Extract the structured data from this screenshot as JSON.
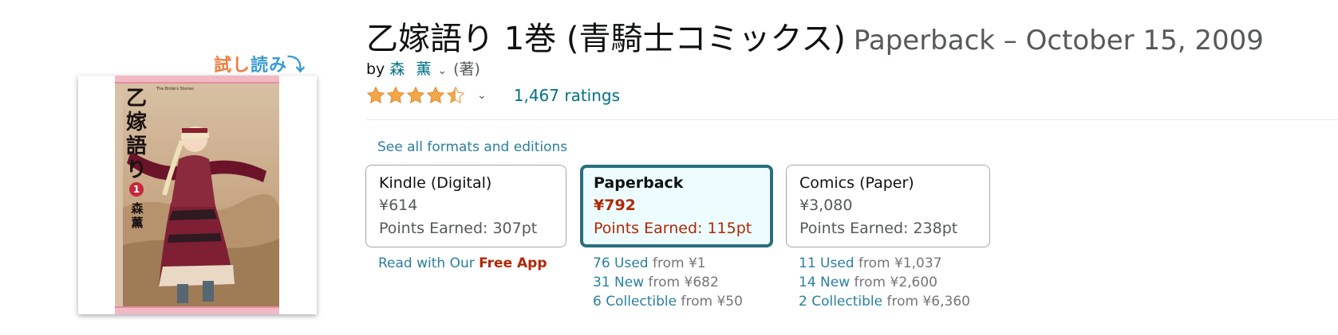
{
  "sample": {
    "part1": "試し",
    "part2": "読み",
    "arrow": "⤵"
  },
  "cover": {
    "title_vertical": [
      "乙",
      "嫁",
      "語",
      "り"
    ],
    "volume": "1",
    "author_vertical": [
      "森",
      "薫"
    ],
    "small_caption": "The Bride's Stories"
  },
  "product": {
    "title": "乙嫁語り 1巻 (青騎士コミックス)",
    "subtitle": "Paperback – October 15, 2009",
    "by_label": "by",
    "author": "森 薫",
    "author_chevron": "⌄",
    "role": "(著)",
    "rating_value": 4.5,
    "rating_chevron": "⌄",
    "ratings_count": "1,467 ratings",
    "see_all": "See all formats and editions"
  },
  "formats": [
    {
      "name": "Kindle (Digital)",
      "price": "¥614",
      "points": "Points Earned: 307pt",
      "selected": false
    },
    {
      "name": "Paperback",
      "price": "¥792",
      "points": "Points Earned: 115pt",
      "selected": true
    },
    {
      "name": "Comics (Paper)",
      "price": "¥3,080",
      "points": "Points Earned: 238pt",
      "selected": false
    }
  ],
  "kindle_extra": {
    "prefix": "Read with Our ",
    "app": "Free App"
  },
  "paperback_offers": [
    {
      "label": "76 Used",
      "from": "from ¥1"
    },
    {
      "label": "31 New",
      "from": "from ¥682"
    },
    {
      "label": "6 Collectible",
      "from": "from ¥50"
    }
  ],
  "comics_offers": [
    {
      "label": "11 Used",
      "from": "from ¥1,037"
    },
    {
      "label": "14 New",
      "from": "from ¥2,600"
    },
    {
      "label": "2 Collectible",
      "from": "from ¥6,360"
    }
  ],
  "colors": {
    "link": "#007185",
    "price_red": "#b12704",
    "star": "#f3a847",
    "selected_border": "#2a6e7e",
    "selected_bg": "#edfdff"
  }
}
